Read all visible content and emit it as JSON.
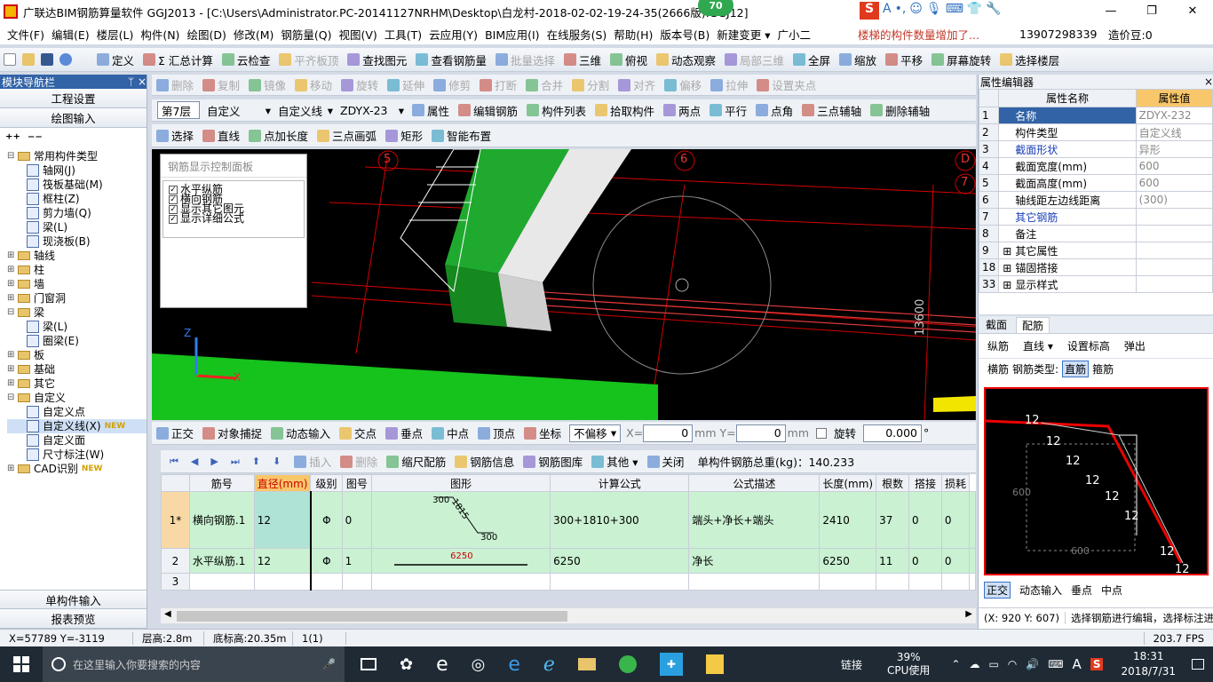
{
  "window": {
    "title": "广联达BIM钢筋算量软件 GGJ2013 - [C:\\Users\\Administrator.PC-20141127NRHM\\Desktop\\白龙村-2018-02-02-19-24-35(2666版).GGJ12]",
    "badge": "70",
    "min": "—",
    "max": "❐",
    "close": "✕"
  },
  "menubar": {
    "items": [
      "文件(F)",
      "编辑(E)",
      "楼层(L)",
      "构件(N)",
      "绘图(D)",
      "修改(M)",
      "钢筋量(Q)",
      "视图(V)",
      "工具(T)",
      "云应用(Y)",
      "BIM应用(I)",
      "在线服务(S)",
      "帮助(H)",
      "版本号(B)",
      "新建变更 ▾",
      "广小二"
    ],
    "notice": "楼梯的构件数量增加了...",
    "phone": "13907298339",
    "coins": "造价豆:0"
  },
  "toolbar1": {
    "items": [
      "定义",
      "Σ 汇总计算",
      "云检查",
      "平齐板顶",
      "查找图元",
      "查看钢筋量",
      "批量选择",
      "三维",
      "俯视",
      "动态观察",
      "局部三维",
      "全屏",
      "缩放",
      "平移",
      "屏幕旋转",
      "选择楼层"
    ]
  },
  "toolbar2": {
    "items": [
      "删除",
      "复制",
      "镜像",
      "移动",
      "旋转",
      "延伸",
      "修剪",
      "打断",
      "合并",
      "分割",
      "对齐",
      "偏移",
      "拉伸",
      "设置夹点"
    ]
  },
  "toolbar3": {
    "floor": "第7层",
    "type": "自定义",
    "subtype": "自定义线",
    "name": "ZDYX-23",
    "items": [
      "属性",
      "编辑钢筋",
      "构件列表",
      "拾取构件",
      "两点",
      "平行",
      "点角",
      "三点辅轴",
      "删除辅轴"
    ]
  },
  "toolbar4": {
    "items": [
      "选择",
      "直线",
      "点加长度",
      "三点画弧",
      "矩形",
      "智能布置"
    ]
  },
  "leftnav": {
    "title": "模块导航栏",
    "pin": "ᛘ",
    "close": "×",
    "btn1": "工程设置",
    "btn2": "绘图输入",
    "btn3": "单构件输入",
    "btn4": "报表预览",
    "tree": [
      {
        "d": 0,
        "e": "⊟",
        "k": "f",
        "t": "常用构件类型"
      },
      {
        "d": 1,
        "k": "i",
        "t": "轴网(J)"
      },
      {
        "d": 1,
        "k": "i",
        "t": "筏板基础(M)"
      },
      {
        "d": 1,
        "k": "i",
        "t": "框柱(Z)"
      },
      {
        "d": 1,
        "k": "i",
        "t": "剪力墙(Q)"
      },
      {
        "d": 1,
        "k": "i",
        "t": "梁(L)"
      },
      {
        "d": 1,
        "k": "i",
        "t": "现浇板(B)"
      },
      {
        "d": 0,
        "e": "⊞",
        "k": "f",
        "t": "轴线"
      },
      {
        "d": 0,
        "e": "⊞",
        "k": "f",
        "t": "柱"
      },
      {
        "d": 0,
        "e": "⊞",
        "k": "f",
        "t": "墙"
      },
      {
        "d": 0,
        "e": "⊞",
        "k": "f",
        "t": "门窗洞"
      },
      {
        "d": 0,
        "e": "⊟",
        "k": "f",
        "t": "梁"
      },
      {
        "d": 1,
        "k": "i",
        "t": "梁(L)"
      },
      {
        "d": 1,
        "k": "i",
        "t": "圈梁(E)"
      },
      {
        "d": 0,
        "e": "⊞",
        "k": "f",
        "t": "板"
      },
      {
        "d": 0,
        "e": "⊞",
        "k": "f",
        "t": "基础"
      },
      {
        "d": 0,
        "e": "⊞",
        "k": "f",
        "t": "其它"
      },
      {
        "d": 0,
        "e": "⊟",
        "k": "f",
        "t": "自定义"
      },
      {
        "d": 1,
        "k": "i",
        "t": "自定义点"
      },
      {
        "d": 1,
        "k": "i",
        "t": "自定义线(X)",
        "tag": "NEW",
        "sel": true
      },
      {
        "d": 1,
        "k": "i",
        "t": "自定义面"
      },
      {
        "d": 1,
        "k": "i",
        "t": "尺寸标注(W)"
      },
      {
        "d": 0,
        "e": "⊞",
        "k": "f",
        "t": "CAD识别",
        "tag": "NEW"
      }
    ]
  },
  "panel": {
    "title": "钢筋显示控制面板",
    "checks": [
      "水平纵筋",
      "横向钢筋",
      "显示其它图元",
      "显示详细公式"
    ]
  },
  "canvas": {
    "axes": [
      "5",
      "6",
      "D",
      "7"
    ],
    "dim": "13600",
    "axis_z": "Z",
    "axis_x": "X"
  },
  "snapbar": {
    "items": [
      "正交",
      "对象捕捉",
      "动态输入",
      "交点",
      "垂点",
      "中点",
      "顶点",
      "坐标"
    ],
    "offset": "不偏移",
    "x_label": "X=",
    "x_val": "0",
    "y_label": "Y=",
    "y_val": "0",
    "unit": "mm",
    "rotate": "旋转",
    "rot_val": "0.000",
    "deg": "°"
  },
  "rebarbar": {
    "items": [
      "插入",
      "删除",
      "缩尺配筋",
      "钢筋信息",
      "钢筋图库",
      "其他 ▾",
      "关闭"
    ],
    "total": "单构件钢筋总重(kg)：140.233"
  },
  "rebar": {
    "headers": [
      "筋号",
      "直径(mm)",
      "级别",
      "图号",
      "图形",
      "计算公式",
      "公式描述",
      "长度(mm)",
      "根数",
      "搭接",
      "损耗"
    ],
    "rows": [
      {
        "no": "1*",
        "name": "横向钢筋.1",
        "dia": "12",
        "grade": "Φ",
        "fig": "0",
        "shape_a": "300",
        "shape_b": "1815",
        "shape_c": "300",
        "formula": "300+1810+300",
        "desc": "端头+净长+端头",
        "len": "2410",
        "cnt": "37",
        "lap": "0",
        "loss": "0"
      },
      {
        "no": "2",
        "name": "水平纵筋.1",
        "dia": "12",
        "grade": "Φ",
        "fig": "1",
        "shape_a": "6250",
        "formula": "6250",
        "desc": "净长",
        "len": "6250",
        "cnt": "11",
        "lap": "0",
        "loss": "0"
      },
      {
        "no": "3"
      }
    ]
  },
  "props": {
    "title": "属性编辑器",
    "h1": "属性名称",
    "h2": "属性值",
    "rows": [
      {
        "no": "1",
        "name": "名称",
        "val": "ZDYX-232",
        "blue": false
      },
      {
        "no": "2",
        "name": "构件类型",
        "val": "自定义线",
        "blue": false
      },
      {
        "no": "3",
        "name": "截面形状",
        "val": "异形",
        "blue": true
      },
      {
        "no": "4",
        "name": "截面宽度(mm)",
        "val": "600",
        "blue": false
      },
      {
        "no": "5",
        "name": "截面高度(mm)",
        "val": "600",
        "blue": false
      },
      {
        "no": "6",
        "name": "轴线距左边线距离",
        "val": "(300)",
        "blue": false
      },
      {
        "no": "7",
        "name": "其它钢筋",
        "val": "",
        "blue": true
      },
      {
        "no": "8",
        "name": "备注",
        "val": "",
        "blue": false
      },
      {
        "no": "9",
        "name": "其它属性",
        "val": "",
        "blue": false,
        "exp": true
      },
      {
        "no": "18",
        "name": "锚固搭接",
        "val": "",
        "blue": false,
        "exp": true
      },
      {
        "no": "33",
        "name": "显示样式",
        "val": "",
        "blue": false,
        "exp": true
      }
    ]
  },
  "section": {
    "tab1": "截面",
    "tab2": "配筋",
    "r1": [
      "纵筋",
      "直线 ▾",
      "设置标高",
      "弹出"
    ],
    "r2": [
      "横筋",
      "钢筋类型:",
      "直筋",
      "箍筋"
    ],
    "bar": "12",
    "dim1": "600",
    "dim2": "600",
    "bottom": [
      "正交",
      "动态输入",
      "垂点",
      "中点"
    ],
    "coord": "(X: 920 Y: 607)",
    "hint": "选择钢筋进行编辑，选择标注进"
  },
  "status": {
    "xy": "X=57789 Y=-3119",
    "floor_h": "层高:2.8m",
    "bottom_h": "底标高:20.35m",
    "sel": "1(1)",
    "fps": "203.7 FPS"
  },
  "taskbar": {
    "search": "在这里输入你要搜索的内容",
    "net": "链接",
    "cpu": "39%",
    "cpu_label": "CPU使用",
    "time": "18:31",
    "date": "2018/7/31",
    "ime": "A"
  }
}
